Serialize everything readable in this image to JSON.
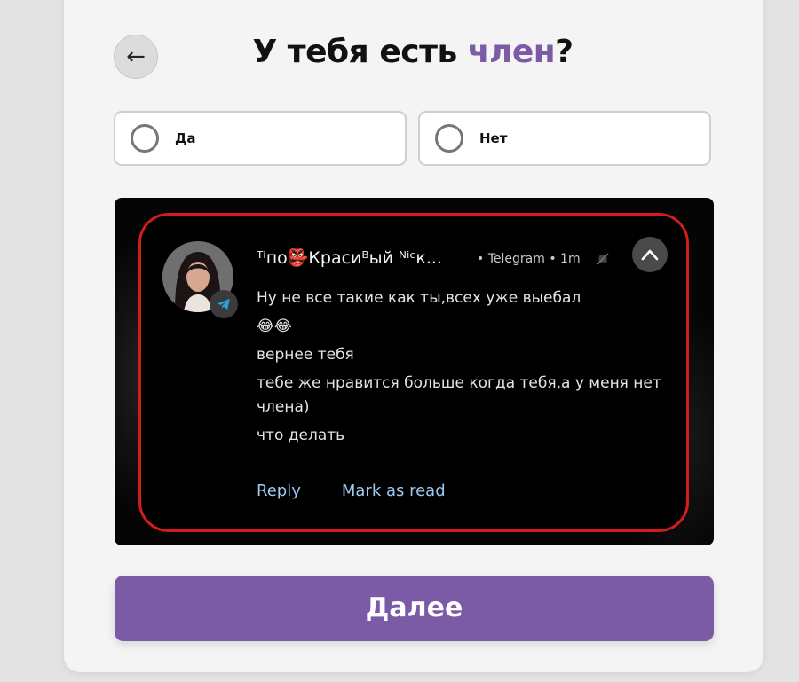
{
  "header": {
    "back_label": "←",
    "title_prefix": "У тебя есть ",
    "title_highlight": "член",
    "title_suffix": "?"
  },
  "options": [
    {
      "label": "Да",
      "selected": false
    },
    {
      "label": "Нет",
      "selected": false
    }
  ],
  "notification": {
    "sender": "ᵀⁱпо👺Красиᴮый ᴺⁱᶜк...",
    "app": "Telegram",
    "time": "1m",
    "separator": "•",
    "message_lines": [
      "Ну не все такие как ты,всех уже выебал",
      "😂😂",
      "вернее тебя",
      "тебе же нравится больше когда тебя,а у меня нет члена)",
      "что делать"
    ],
    "actions": [
      "Reply",
      "Mark as read"
    ],
    "highlight_color": "#d31d1d",
    "action_color": "#9ec9ee"
  },
  "footer": {
    "next_label": "Далее"
  },
  "colors": {
    "accent": "#7b5aa6",
    "background": "#f4f4f4"
  },
  "icons": {
    "back": "arrow-left-icon",
    "telegram": "telegram-icon",
    "collapse": "chevron-up-icon",
    "bell": "bell-muted-icon"
  }
}
